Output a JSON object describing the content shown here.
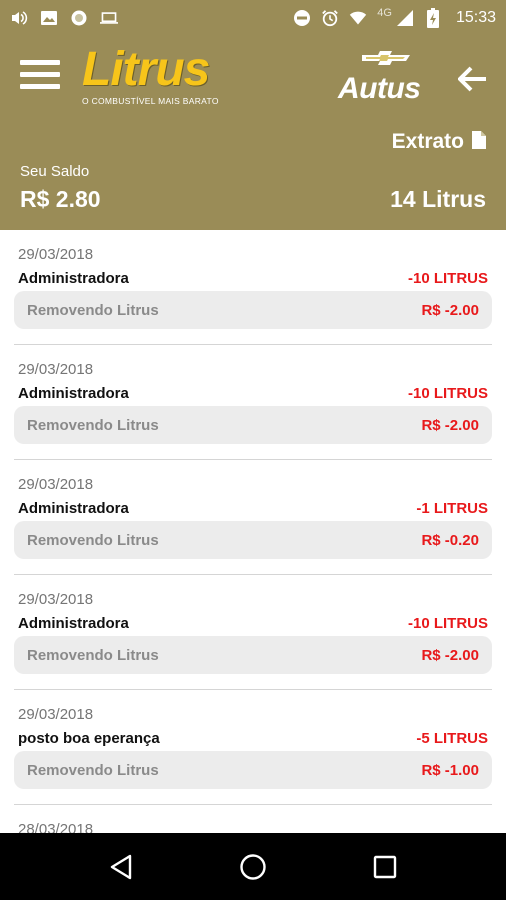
{
  "status_bar": {
    "network": "4G",
    "time": "15:33",
    "icons": [
      "volume-icon",
      "image-icon",
      "circle-icon",
      "laptop-icon",
      "do-not-disturb-icon",
      "alarm-icon",
      "wifi-icon",
      "signal-icon",
      "battery-charging-icon"
    ]
  },
  "header": {
    "logo": "Litrus",
    "tagline": "O COMBUSTÍVEL MAIS BARATO",
    "partner": "Autus",
    "extrato_label": "Extrato",
    "saldo_label": "Seu Saldo",
    "saldo_value": "R$ 2.80",
    "litrus_balance": "14 Litrus",
    "colors": {
      "header_bg": "#9a8c57",
      "logo": "#f7c51a",
      "negative": "#e8191b"
    }
  },
  "transactions": [
    {
      "date": "29/03/2018",
      "name": "Administradora",
      "litrus": "-10 LITRUS",
      "description": "Removendo Litrus",
      "amount": "R$ -2.00"
    },
    {
      "date": "29/03/2018",
      "name": "Administradora",
      "litrus": "-10 LITRUS",
      "description": "Removendo Litrus",
      "amount": "R$ -2.00"
    },
    {
      "date": "29/03/2018",
      "name": "Administradora",
      "litrus": "-1 LITRUS",
      "description": "Removendo Litrus",
      "amount": "R$ -0.20"
    },
    {
      "date": "29/03/2018",
      "name": "Administradora",
      "litrus": "-10 LITRUS",
      "description": "Removendo Litrus",
      "amount": "R$ -2.00"
    },
    {
      "date": "29/03/2018",
      "name": "posto boa eperança",
      "litrus": "-5 LITRUS",
      "description": "Removendo Litrus",
      "amount": "R$ -1.00"
    },
    {
      "date": "28/03/2018",
      "name": "",
      "litrus": "",
      "description": "",
      "amount": ""
    }
  ],
  "nav_bar": {
    "icons": [
      "back-triangle-icon",
      "home-circle-icon",
      "recents-square-icon"
    ]
  }
}
